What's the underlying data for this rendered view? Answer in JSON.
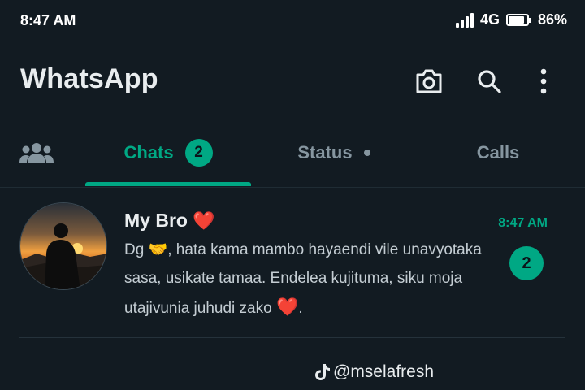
{
  "status_bar": {
    "time": "8:47 AM",
    "network": "4G",
    "battery": "86%",
    "battery_level": 0.86,
    "signal_icon": "signal-bars-icon"
  },
  "app_bar": {
    "title": "WhatsApp",
    "actions": [
      "camera-icon",
      "search-icon",
      "more-vert-icon"
    ]
  },
  "tabs": {
    "community_icon": "community-icon",
    "chats_label": "Chats",
    "chats_badge": "2",
    "status_label": "Status",
    "calls_label": "Calls",
    "selected": "Chats"
  },
  "chats": [
    {
      "name": "My Bro",
      "name_emoji": "❤️",
      "time": "8:47 AM",
      "unread": "2",
      "preview_start": "Dg",
      "preview_emoji_1": "🤝",
      "preview_mid": ", hata kama mambo hayaendi vile unavyotaka sasa, usikate tamaa. Endelea kujituma, siku moja utajivunia juhudi zako",
      "preview_emoji_2": "❤️",
      "preview_end": "."
    }
  ],
  "watermark": {
    "icon": "tiktok-icon",
    "text": "@mselafresh"
  },
  "colors": {
    "background": "#121b22",
    "accent": "#00a884",
    "muted": "#8696a0",
    "text": "#e9edef",
    "heart": "#f02849"
  }
}
